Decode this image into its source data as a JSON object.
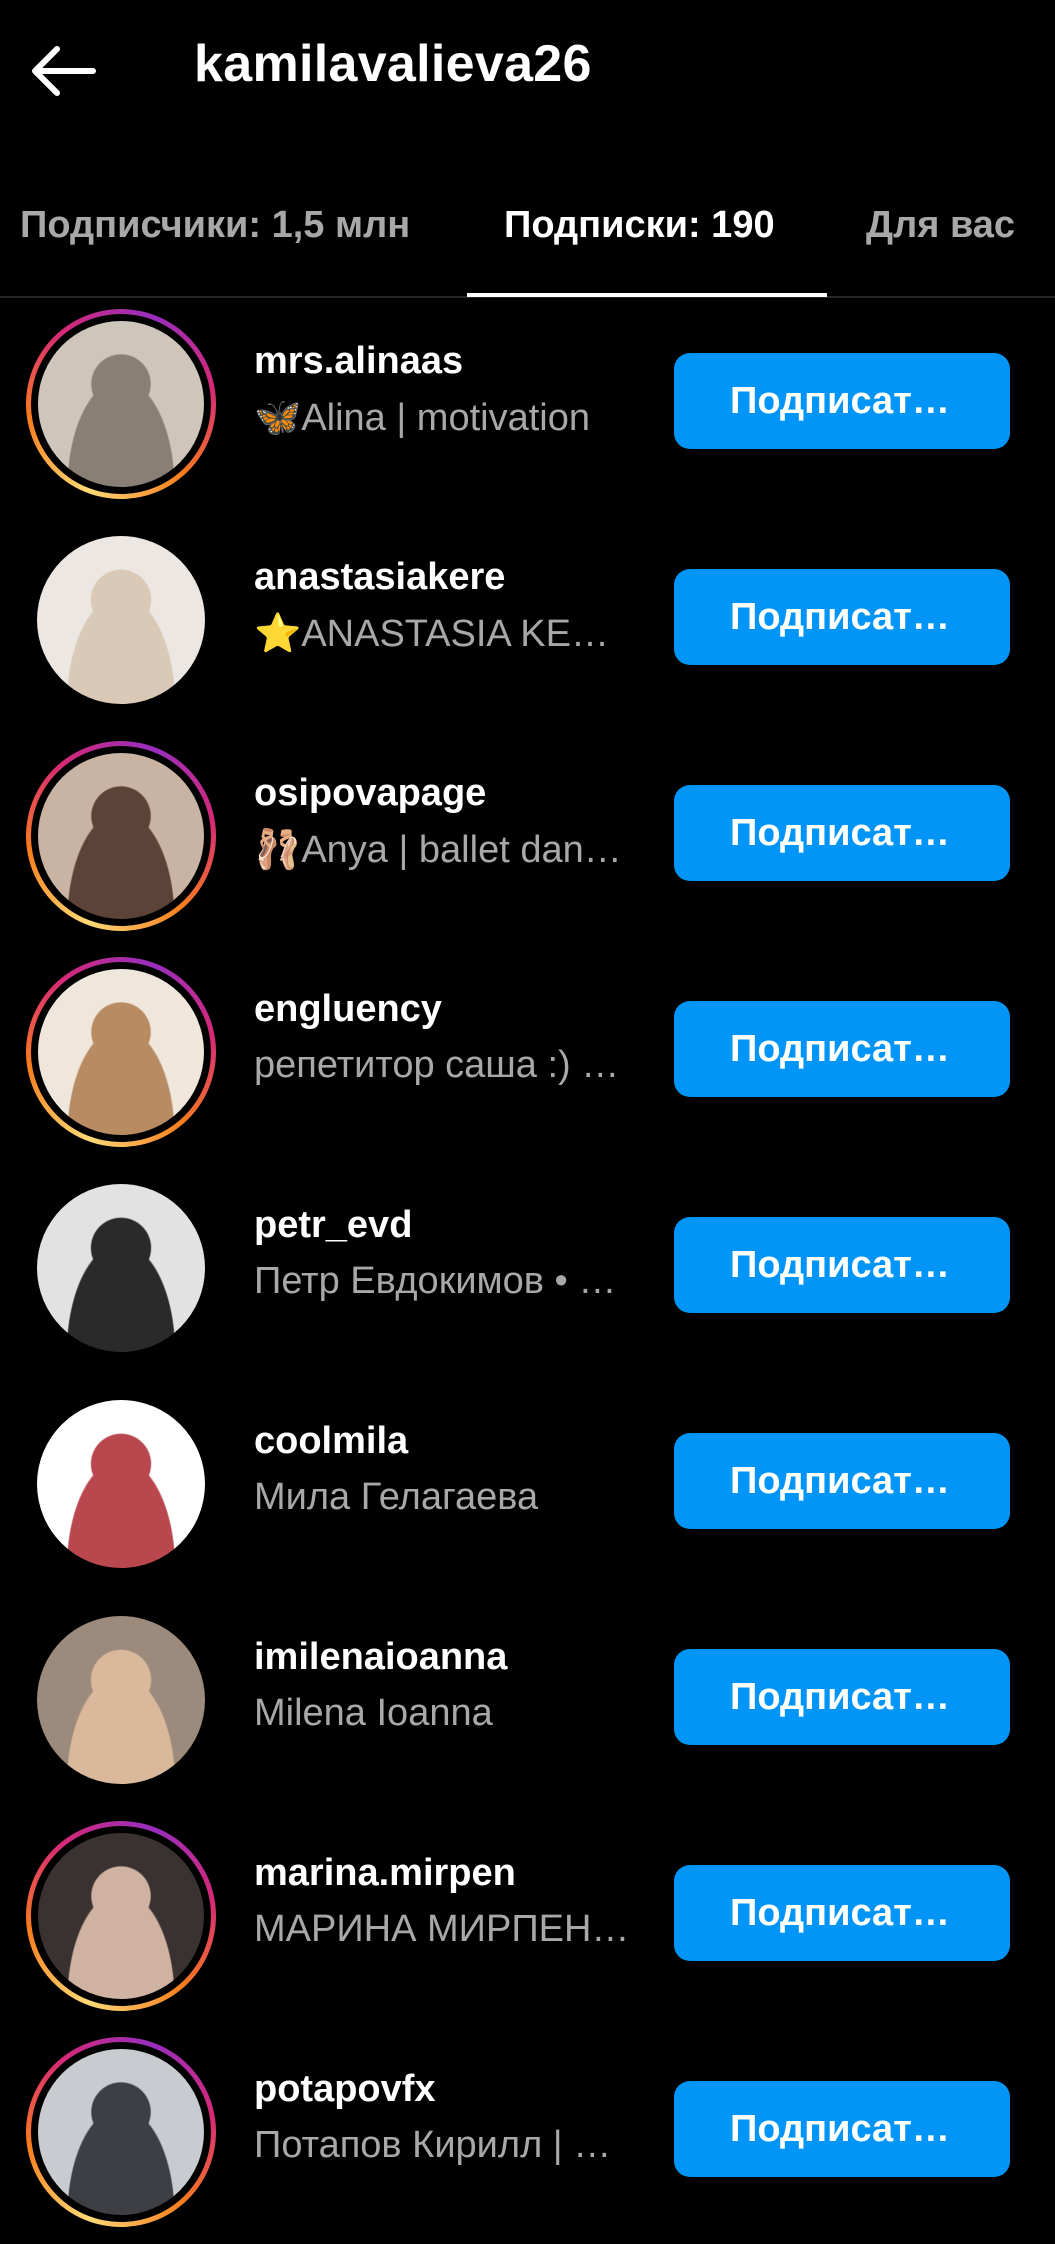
{
  "header": {
    "title": "kamilavalieva26",
    "back_icon": "arrow-left-icon"
  },
  "tabs": [
    {
      "label": "Подписчики: 1,5 млн",
      "active": false
    },
    {
      "label": "Подписки: 190",
      "active": true
    },
    {
      "label": "Для вас",
      "active": false
    }
  ],
  "colors": {
    "background": "#000000",
    "accent": "#0095f6",
    "secondary_text": "#a8a8a8"
  },
  "accounts": [
    {
      "username": "mrs.alinaas",
      "full_name": "🦋Alina | motivation",
      "button": "Подписаться",
      "story_ring": true,
      "avatar_colors": [
        "#cfc6bb",
        "#8a7f74"
      ]
    },
    {
      "username": "anastasiakere",
      "full_name": "⭐ANASTASIA KEREZ",
      "button": "Подписаться",
      "story_ring": false,
      "avatar_colors": [
        "#ece7e2",
        "#d9c9b6"
      ]
    },
    {
      "username": "osipovapage",
      "full_name": "🩰Anya | ballet dancer",
      "button": "Подписаться",
      "story_ring": true,
      "avatar_colors": [
        "#c9b3a3",
        "#5b4437"
      ]
    },
    {
      "username": "engluency",
      "full_name": "репетитор саша :) английский",
      "button": "Подписаться",
      "story_ring": true,
      "avatar_colors": [
        "#efe6dc",
        "#b98b62"
      ]
    },
    {
      "username": "petr_evd",
      "full_name": "Петр Евдокимов • артист",
      "button": "Подписаться",
      "story_ring": false,
      "avatar_colors": [
        "#e2e2e2",
        "#2a2a2a"
      ]
    },
    {
      "username": "coolmila",
      "full_name": "Мила Гелагаева",
      "button": "Подписаться",
      "story_ring": false,
      "avatar_colors": [
        "#ffffff",
        "#b8474e"
      ]
    },
    {
      "username": "imilenaioanna",
      "full_name": "Milena Ioanna",
      "button": "Подписаться",
      "story_ring": false,
      "avatar_colors": [
        "#9c8b7c",
        "#d9b89c"
      ]
    },
    {
      "username": "marina.mirpen",
      "full_name": "МАРИНА МИРПЕНОВА",
      "button": "Подписаться",
      "story_ring": true,
      "avatar_colors": [
        "#3a3230",
        "#cfb2a2"
      ]
    },
    {
      "username": "potapovfx",
      "full_name": "Потапов Кирилл | фотограф",
      "button": "Подписаться",
      "story_ring": true,
      "avatar_colors": [
        "#c8ccd0",
        "#3d3f44"
      ]
    }
  ]
}
